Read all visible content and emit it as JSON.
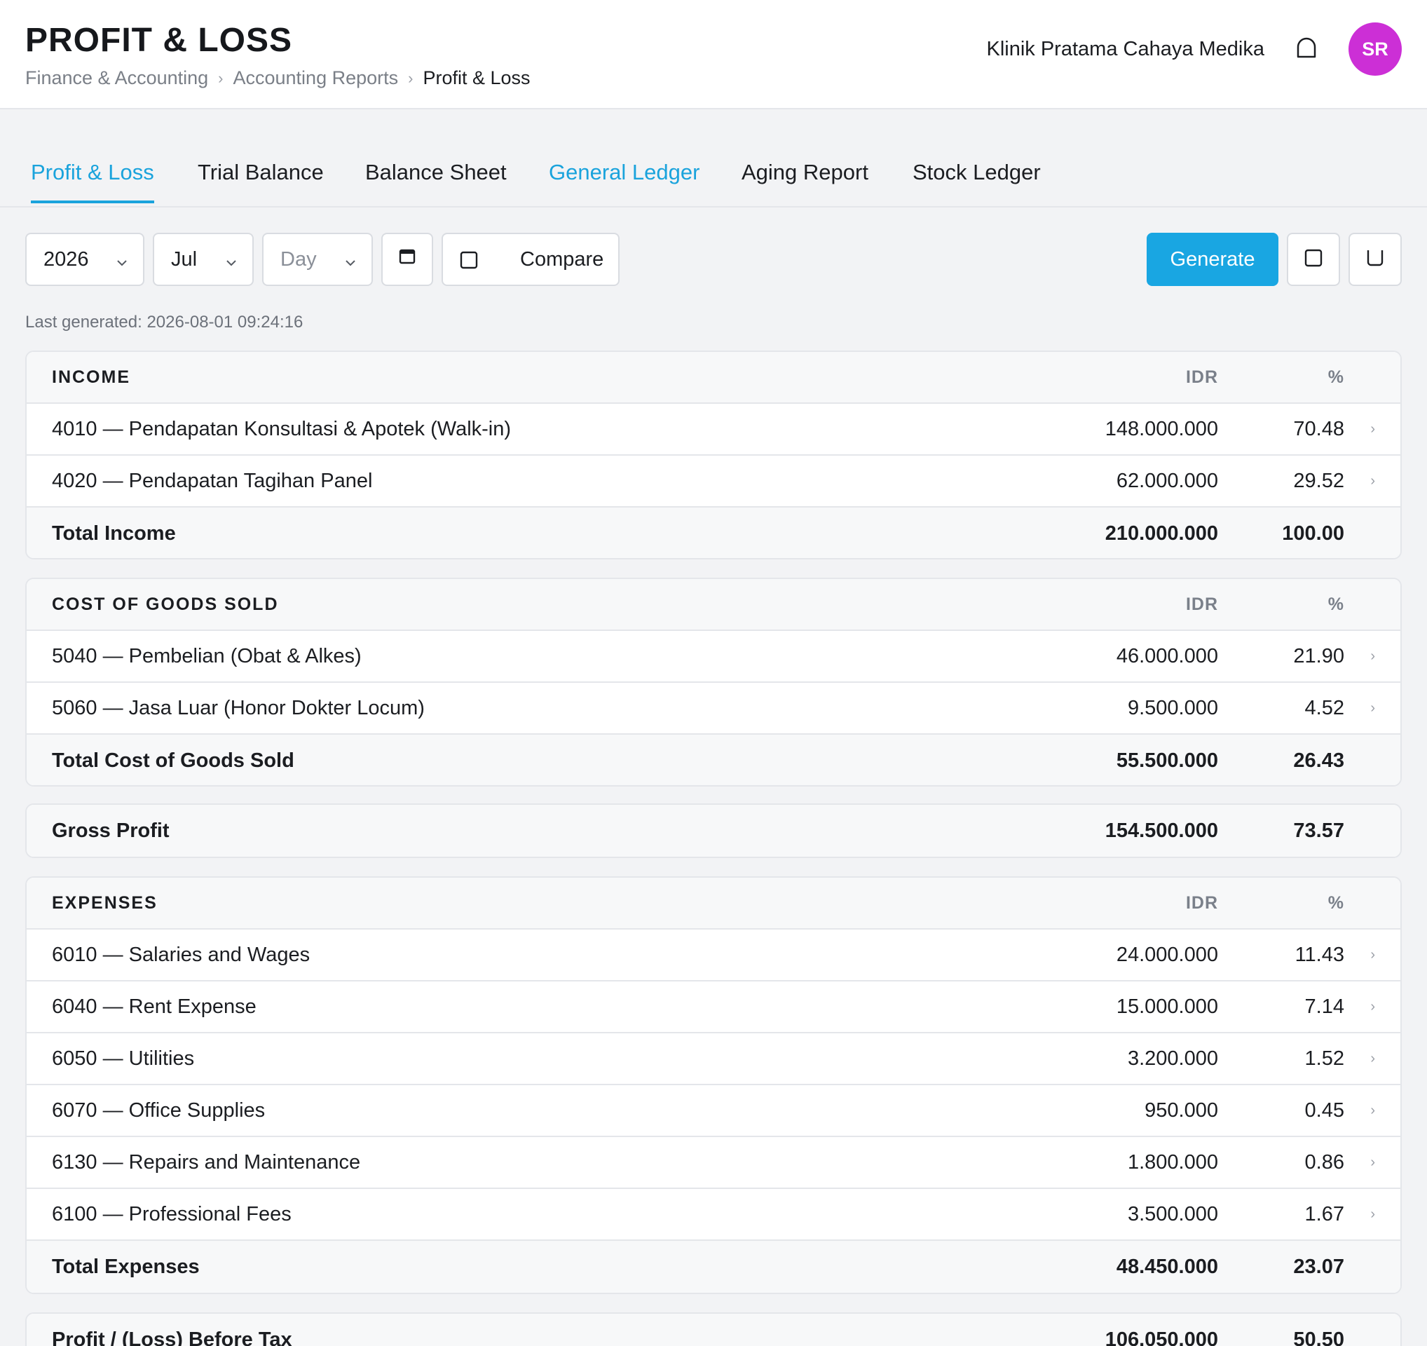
{
  "header": {
    "title": "PROFIT & LOSS",
    "breadcrumb": [
      "Finance & Accounting",
      "Accounting Reports",
      "Profit & Loss"
    ],
    "breadcrumb_sep": "›",
    "clinic_name": "Klinik Pratama Cahaya Medika",
    "avatar_initials": "SR",
    "avatar_color": "#cc2fd6"
  },
  "tabs": [
    "Profit & Loss",
    "Trial Balance",
    "Balance Sheet",
    "General Ledger",
    "Aging Report",
    "Stock Ledger"
  ],
  "toolbar": {
    "year": "2026",
    "month": "Jul",
    "day_placeholder": "Day",
    "compare_label": "Compare",
    "generate_label": "Generate",
    "accent_color": "#19a6e2"
  },
  "last_generated": "Last generated: 2026-08-01 09:24:16",
  "columns": {
    "idr": "IDR",
    "pct": "%"
  },
  "income": {
    "heading": "INCOME",
    "rows": [
      {
        "label": "4010 — Pendapatan Konsultasi & Apotek (Walk-in)",
        "idr": "148.000.000",
        "pct": "70.48"
      },
      {
        "label": "4020 — Pendapatan Tagihan Panel",
        "idr": "62.000.000",
        "pct": "29.52"
      }
    ],
    "total": {
      "label": "Total Income",
      "idr": "210.000.000",
      "pct": "100.00"
    }
  },
  "cogs": {
    "heading": "COST OF GOODS SOLD",
    "rows": [
      {
        "label": "5040 — Pembelian (Obat & Alkes)",
        "idr": "46.000.000",
        "pct": "21.90"
      },
      {
        "label": "5060 — Jasa Luar (Honor Dokter Locum)",
        "idr": "9.500.000",
        "pct": "4.52"
      }
    ],
    "total": {
      "label": "Total Cost of Goods Sold",
      "idr": "55.500.000",
      "pct": "26.43"
    }
  },
  "gross_profit": {
    "label": "Gross Profit",
    "idr": "154.500.000",
    "pct": "73.57"
  },
  "expenses": {
    "heading": "EXPENSES",
    "rows": [
      {
        "label": "6010 — Salaries and Wages",
        "idr": "24.000.000",
        "pct": "11.43"
      },
      {
        "label": "6040 — Rent Expense",
        "idr": "15.000.000",
        "pct": "7.14"
      },
      {
        "label": "6050 — Utilities",
        "idr": "3.200.000",
        "pct": "1.52"
      },
      {
        "label": "6070 — Office Supplies",
        "idr": "950.000",
        "pct": "0.45"
      },
      {
        "label": "6130 — Repairs and Maintenance",
        "idr": "1.800.000",
        "pct": "0.86"
      },
      {
        "label": "6100 — Professional Fees",
        "idr": "3.500.000",
        "pct": "1.67"
      }
    ],
    "total": {
      "label": "Total Expenses",
      "idr": "48.450.000",
      "pct": "23.07"
    }
  },
  "profit_before_tax": {
    "label": "Profit / (Loss) Before Tax",
    "idr": "106.050.000",
    "pct": "50.50"
  },
  "row_arrow": "›"
}
